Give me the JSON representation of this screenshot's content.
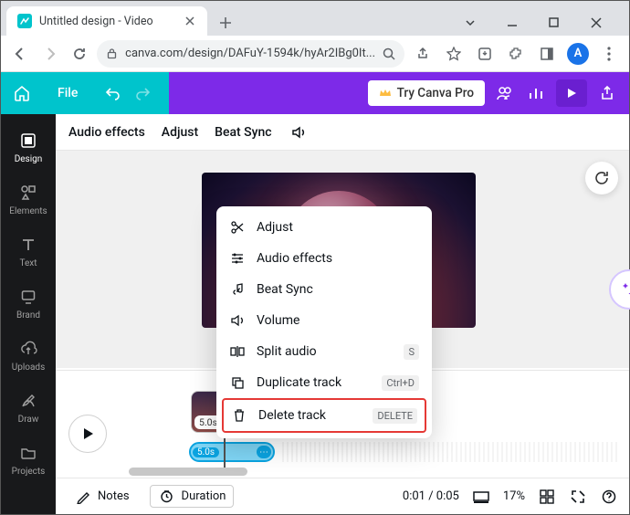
{
  "browser": {
    "tab_title": "Untitled design - Video",
    "url_display": "canva.com/design/DAFuY-1594k/hyAr2IBg0It...",
    "avatar_initial": "A"
  },
  "canva_top": {
    "file_label": "File",
    "pro_label": "Try Canva Pro"
  },
  "sidebar": {
    "items": [
      {
        "label": "Design"
      },
      {
        "label": "Elements"
      },
      {
        "label": "Text"
      },
      {
        "label": "Brand"
      },
      {
        "label": "Uploads"
      },
      {
        "label": "Draw"
      },
      {
        "label": "Projects"
      }
    ]
  },
  "sec_bar": {
    "audio_effects": "Audio effects",
    "adjust": "Adjust",
    "beat_sync": "Beat Sync"
  },
  "timeline": {
    "clip_duration": "5.0s",
    "audio_duration": "5.0s"
  },
  "bottombar": {
    "notes": "Notes",
    "duration": "Duration",
    "time": "0:01 / 0:05",
    "zoom": "17%"
  },
  "ctx": {
    "adjust": "Adjust",
    "audio_effects": "Audio effects",
    "beat_sync": "Beat Sync",
    "volume": "Volume",
    "split_audio": "Split audio",
    "split_sc": "S",
    "duplicate": "Duplicate track",
    "duplicate_sc": "Ctrl+D",
    "delete": "Delete track",
    "delete_sc": "DELETE"
  }
}
